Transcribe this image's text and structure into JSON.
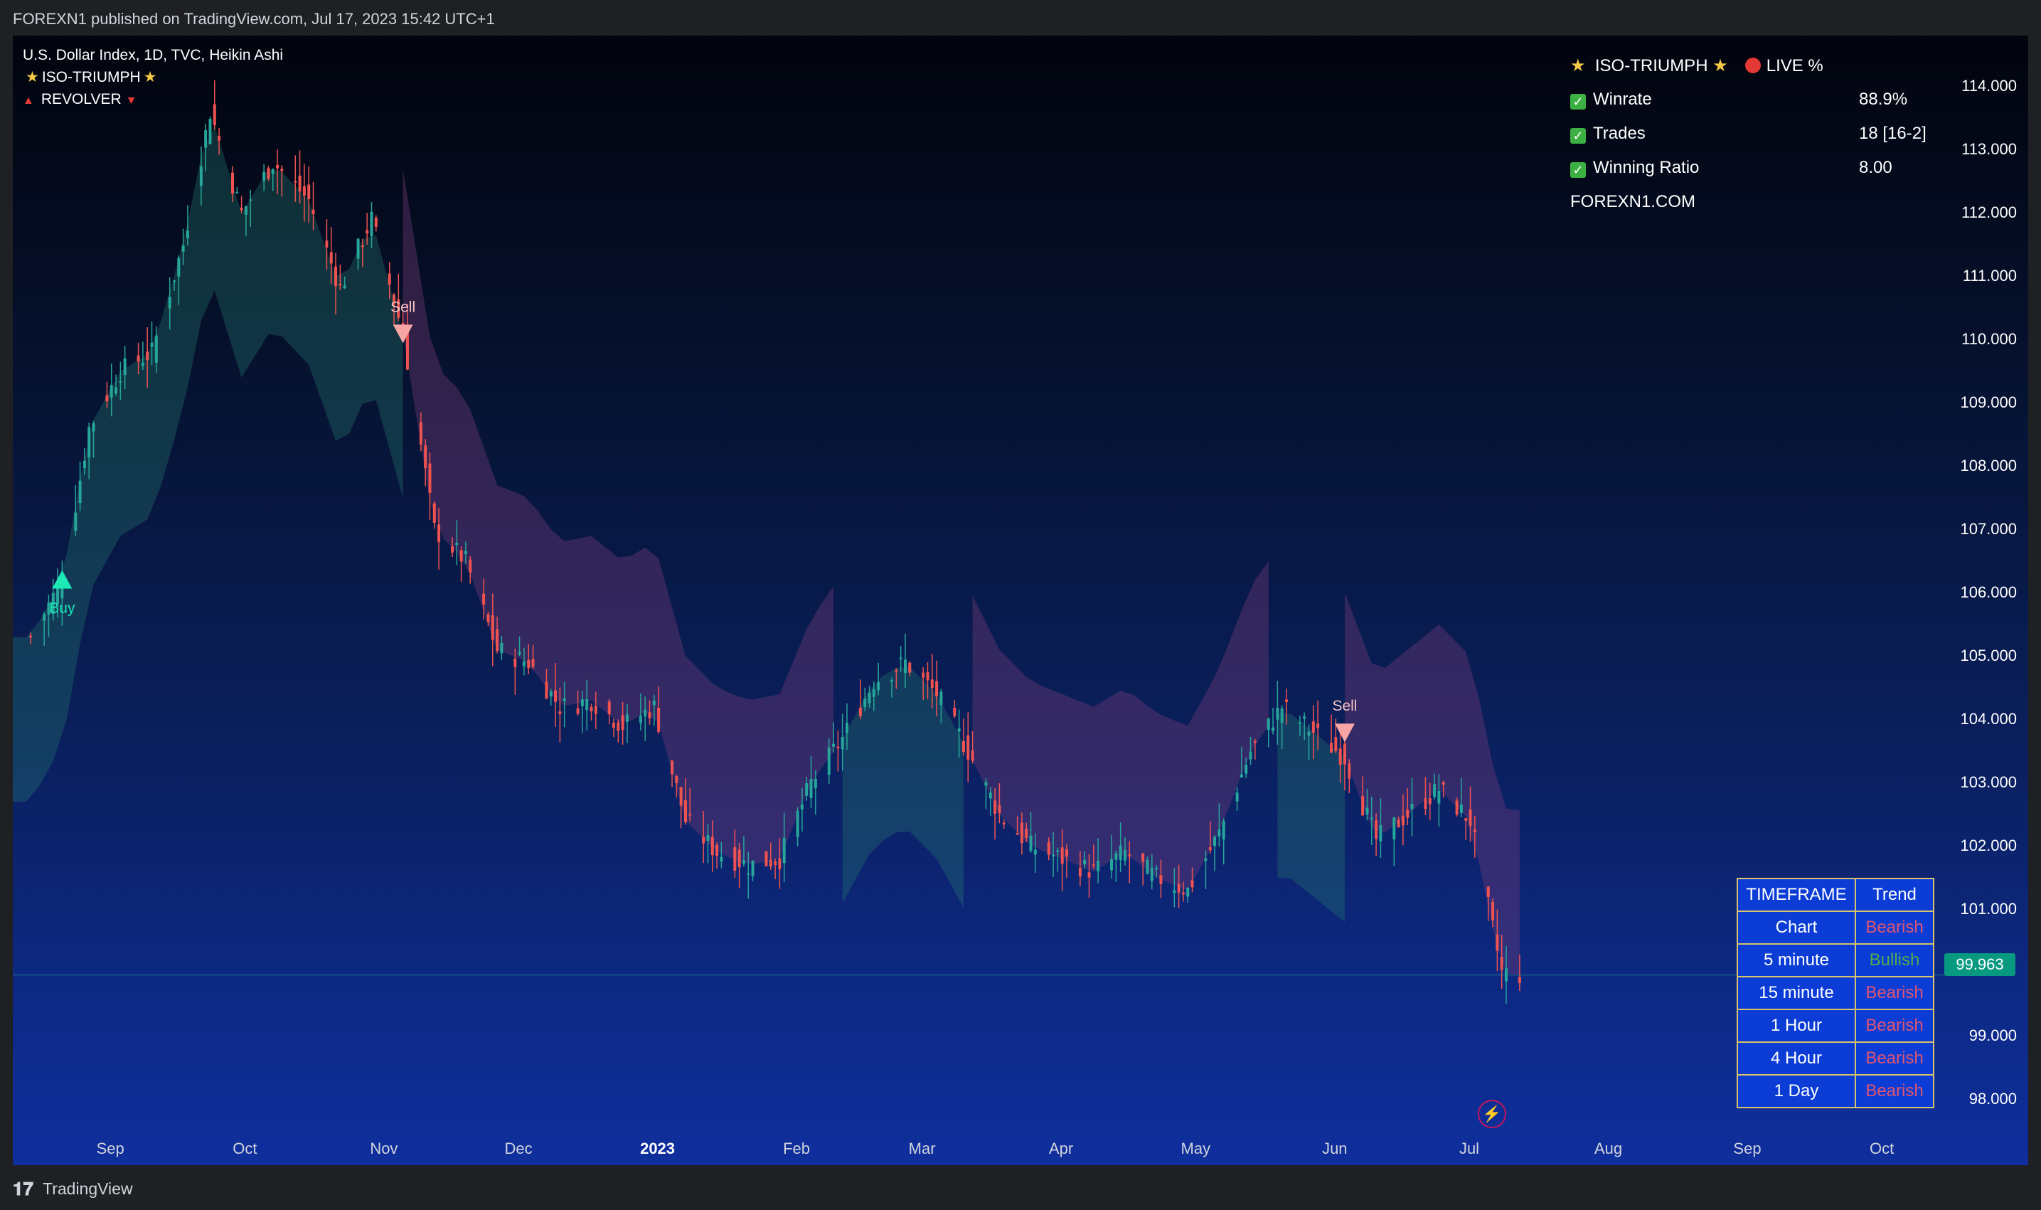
{
  "header": {
    "published_text": "FOREXN1 published on TradingView.com, Jul 17, 2023 15:42 UTC+1"
  },
  "legend": {
    "symbol_line": "U.S. Dollar Index, 1D, TVC, Heikin Ashi",
    "indicator_1": "ISO-TRIUMPH",
    "indicator_2": "REVOLVER"
  },
  "stats_panel": {
    "title": "ISO-TRIUMPH",
    "live_label": "LIVE %",
    "rows": [
      {
        "label": "Winrate",
        "value": "88.9%"
      },
      {
        "label": "Trades",
        "value": "18 [16-2]"
      },
      {
        "label": "Winning Ratio",
        "value": "8.00"
      }
    ],
    "website": "FOREXN1.COM"
  },
  "price_axis": {
    "ticks": [
      "114.000",
      "113.000",
      "112.000",
      "111.000",
      "110.000",
      "109.000",
      "108.000",
      "107.000",
      "106.000",
      "105.000",
      "104.000",
      "103.000",
      "102.000",
      "101.000",
      "99.000",
      "98.000"
    ]
  },
  "current_price": "99.963",
  "time_axis": {
    "labels": [
      "Sep",
      "Oct",
      "Nov",
      "Dec",
      "2023",
      "Feb",
      "Mar",
      "Apr",
      "May",
      "Jun",
      "Jul",
      "Aug",
      "Sep",
      "Oct"
    ]
  },
  "signals": [
    {
      "label": "Buy",
      "date": "2022-08-26",
      "price": 106.2
    },
    {
      "label": "Sell",
      "date": "2022-11-10",
      "price": 110.1
    },
    {
      "label": "Sell",
      "date": "2023-06-08",
      "price": 103.8
    }
  ],
  "trend_table": {
    "headers": [
      "TIMEFRAME",
      "Trend"
    ],
    "rows": [
      {
        "timeframe": "Chart",
        "trend": "Bearish"
      },
      {
        "timeframe": "5 minute",
        "trend": "Bullish"
      },
      {
        "timeframe": "15 minute",
        "trend": "Bearish"
      },
      {
        "timeframe": "1 Hour",
        "trend": "Bearish"
      },
      {
        "timeframe": "4 Hour",
        "trend": "Bearish"
      },
      {
        "timeframe": "1 Day",
        "trend": "Bearish"
      }
    ]
  },
  "footer": {
    "brand": "TradingView"
  },
  "colors": {
    "bullish": "#26a69a",
    "bearish": "#ef5350",
    "table_bg": "#0b3dd6",
    "table_border": "#d8c26a",
    "bullish_text": "#4caf50",
    "bearish_text": "#e05570"
  },
  "chart_data": {
    "type": "line",
    "title": "",
    "xlabel": "",
    "ylabel": "",
    "ylim": [
      97.5,
      114.8
    ],
    "x": [
      "2022-08-19",
      "2022-08-26",
      "2022-09-01",
      "2022-09-08",
      "2022-09-15",
      "2022-09-22",
      "2022-09-28",
      "2022-10-05",
      "2022-10-12",
      "2022-10-20",
      "2022-10-27",
      "2022-11-03",
      "2022-11-10",
      "2022-11-17",
      "2022-11-24",
      "2022-12-01",
      "2022-12-08",
      "2022-12-15",
      "2022-12-22",
      "2022-12-29",
      "2023-01-05",
      "2023-01-12",
      "2023-01-19",
      "2023-01-26",
      "2023-02-02",
      "2023-02-09",
      "2023-02-16",
      "2023-02-23",
      "2023-03-02",
      "2023-03-09",
      "2023-03-16",
      "2023-03-23",
      "2023-03-30",
      "2023-04-06",
      "2023-04-13",
      "2023-04-20",
      "2023-04-27",
      "2023-05-04",
      "2023-05-11",
      "2023-05-18",
      "2023-05-25",
      "2023-06-01",
      "2023-06-08",
      "2023-06-15",
      "2023-06-22",
      "2023-06-29",
      "2023-07-06",
      "2023-07-13",
      "2023-07-17"
    ],
    "series": [
      {
        "values": [
          105.3,
          106.2,
          108.6,
          109.5,
          109.8,
          111.5,
          113.6,
          112.0,
          112.8,
          112.2,
          110.8,
          111.9,
          110.1,
          107.0,
          106.5,
          105.1,
          104.9,
          104.2,
          104.3,
          103.9,
          104.2,
          102.4,
          101.9,
          101.7,
          101.8,
          103.0,
          103.7,
          104.6,
          104.9,
          104.4,
          103.5,
          102.5,
          102.0,
          101.8,
          101.6,
          101.9,
          101.5,
          101.3,
          102.2,
          103.5,
          104.2,
          103.8,
          103.4,
          102.1,
          102.5,
          102.9,
          102.4,
          100.0,
          99.963
        ]
      }
    ]
  }
}
